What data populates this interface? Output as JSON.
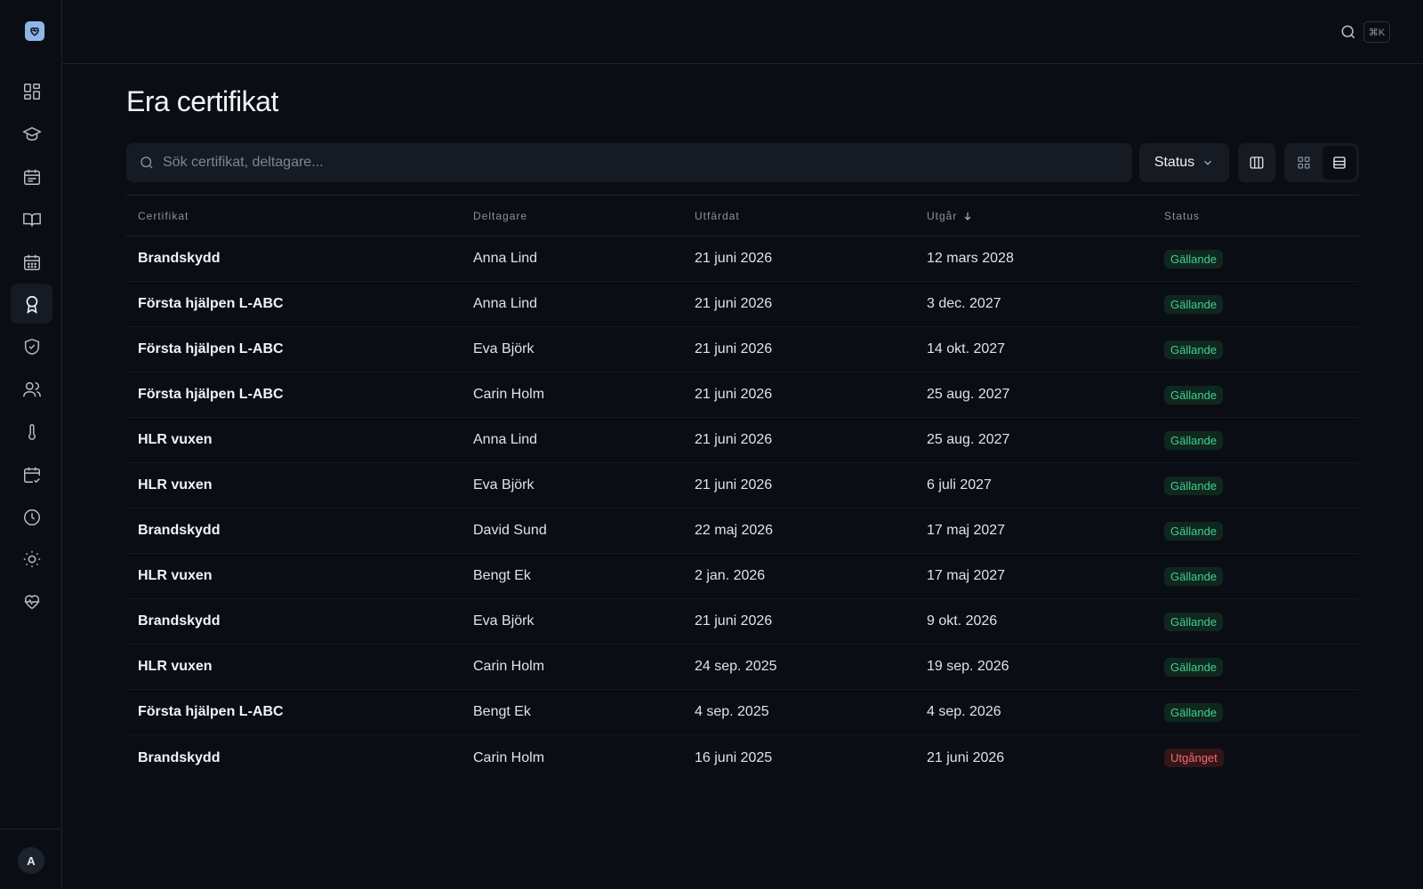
{
  "topbar": {
    "shortcut": "⌘K"
  },
  "user": {
    "initial": "A"
  },
  "page": {
    "title": "Era certifikat"
  },
  "toolbar": {
    "search_placeholder": "Sök certifikat, deltagare...",
    "status_label": "Status"
  },
  "table": {
    "headers": {
      "certificate": "Certifikat",
      "participant": "Deltagare",
      "issued": "Utfärdat",
      "expires": "Utgår",
      "status": "Status"
    },
    "rows": [
      {
        "certificate": "Brandskydd",
        "participant": "Anna Lind",
        "issued": "21 juni 2026",
        "expires": "12 mars 2028",
        "status": "Gällande"
      },
      {
        "certificate": "Första hjälpen L-ABC",
        "participant": "Anna Lind",
        "issued": "21 juni 2026",
        "expires": "3 dec. 2027",
        "status": "Gällande"
      },
      {
        "certificate": "Första hjälpen L-ABC",
        "participant": "Eva Björk",
        "issued": "21 juni 2026",
        "expires": "14 okt. 2027",
        "status": "Gällande"
      },
      {
        "certificate": "Första hjälpen L-ABC",
        "participant": "Carin Holm",
        "issued": "21 juni 2026",
        "expires": "25 aug. 2027",
        "status": "Gällande"
      },
      {
        "certificate": "HLR vuxen",
        "participant": "Anna Lind",
        "issued": "21 juni 2026",
        "expires": "25 aug. 2027",
        "status": "Gällande"
      },
      {
        "certificate": "HLR vuxen",
        "participant": "Eva Björk",
        "issued": "21 juni 2026",
        "expires": "6 juli 2027",
        "status": "Gällande"
      },
      {
        "certificate": "Brandskydd",
        "participant": "David Sund",
        "issued": "22 maj 2026",
        "expires": "17 maj 2027",
        "status": "Gällande"
      },
      {
        "certificate": "HLR vuxen",
        "participant": "Bengt Ek",
        "issued": "2 jan. 2026",
        "expires": "17 maj 2027",
        "status": "Gällande"
      },
      {
        "certificate": "Brandskydd",
        "participant": "Eva Björk",
        "issued": "21 juni 2026",
        "expires": "9 okt. 2026",
        "status": "Gällande"
      },
      {
        "certificate": "HLR vuxen",
        "participant": "Carin Holm",
        "issued": "24 sep. 2025",
        "expires": "19 sep. 2026",
        "status": "Gällande"
      },
      {
        "certificate": "Första hjälpen L-ABC",
        "participant": "Bengt Ek",
        "issued": "4 sep. 2025",
        "expires": "4 sep. 2026",
        "status": "Gällande"
      },
      {
        "certificate": "Brandskydd",
        "participant": "Carin Holm",
        "issued": "16 juni 2025",
        "expires": "21 juni 2026",
        "status": "Utgånget"
      }
    ]
  },
  "colors": {
    "valid": "#3fcf8e",
    "expired": "#f06a72",
    "logo": "#8fb6e6"
  },
  "icons": [
    "heart-logo-icon",
    "dashboard-icon",
    "graduation-cap-icon",
    "calendar-list-icon",
    "book-open-icon",
    "calendar-icon",
    "award-icon",
    "shield-check-icon",
    "users-icon",
    "thermometer-icon",
    "calendar-check-icon",
    "clock-icon",
    "sun-icon",
    "heart-pulse-icon",
    "search-icon",
    "chevron-down-icon",
    "columns-icon",
    "grid-icon",
    "list-icon",
    "arrow-down-icon"
  ]
}
